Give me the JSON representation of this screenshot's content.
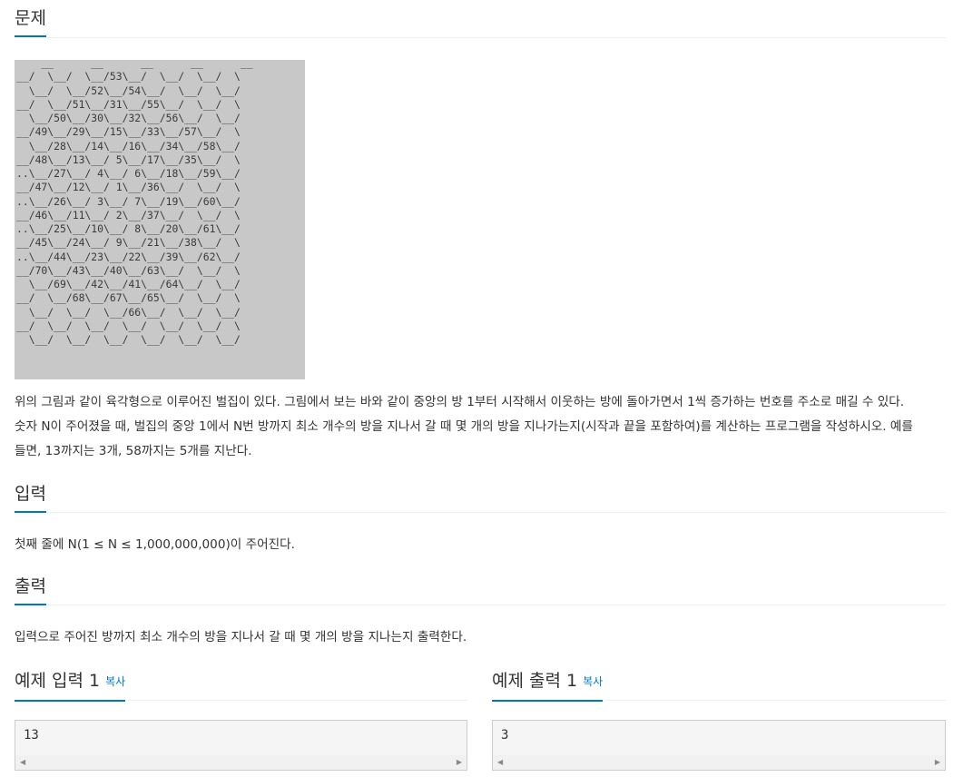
{
  "problem": {
    "title": "문제",
    "figure_text": "    __      __      __      __      __\n__/  \\__/  \\__/53\\__/  \\__/  \\__/  \\\n  \\__/  \\__/52\\__/54\\__/  \\__/  \\__/\n__/  \\__/51\\__/31\\__/55\\__/  \\__/  \\\n  \\__/50\\__/30\\__/32\\__/56\\__/  \\__/\n__/49\\__/29\\__/15\\__/33\\__/57\\__/  \\\n  \\__/28\\__/14\\__/16\\__/34\\__/58\\__/\n__/48\\__/13\\__/ 5\\__/17\\__/35\\__/  \\\n..\\__/27\\__/ 4\\__/ 6\\__/18\\__/59\\__/\n__/47\\__/12\\__/ 1\\__/36\\__/  \\__/  \\\n..\\__/26\\__/ 3\\__/ 7\\__/19\\__/60\\__/\n__/46\\__/11\\__/ 2\\__/37\\__/  \\__/  \\\n..\\__/25\\__/10\\__/ 8\\__/20\\__/61\\__/\n__/45\\__/24\\__/ 9\\__/21\\__/38\\__/  \\\n..\\__/44\\__/23\\__/22\\__/39\\__/62\\__/\n__/70\\__/43\\__/40\\__/63\\__/  \\__/  \\\n  \\__/69\\__/42\\__/41\\__/64\\__/  \\__/\n__/  \\__/68\\__/67\\__/65\\__/  \\__/  \\\n  \\__/  \\__/  \\__/66\\__/  \\__/  \\__/\n__/  \\__/  \\__/  \\__/  \\__/  \\__/  \\\n  \\__/  \\__/  \\__/  \\__/  \\__/  \\__/",
    "desc_line1": "위의 그림과 같이 육각형으로 이루어진 벌집이 있다. 그림에서 보는 바와 같이 중앙의 방 1부터 시작해서 이웃하는 방에 돌아가면서 1씩 증가하는 번호를 주소로 매길 수 있다.",
    "desc_line2": "숫자 N이 주어졌을 때, 벌집의 중앙 1에서 N번 방까지 최소 개수의 방을 지나서 갈 때 몇 개의 방을 지나가는지(시작과 끝을 포함하여)를 계산하는 프로그램을 작성하시오. 예를",
    "desc_line3": "들면, 13까지는 3개, 58까지는 5개를 지난다."
  },
  "input": {
    "title": "입력",
    "text": "첫째 줄에 N(1 ≤ N ≤ 1,000,000,000)이 주어진다."
  },
  "output": {
    "title": "출력",
    "text": "입력으로 주어진 방까지 최소 개수의 방을 지나서 갈 때 몇 개의 방을 지나는지 출력한다."
  },
  "sample_input": {
    "title": "예제 입력 1",
    "copy_label": "복사",
    "value": "13"
  },
  "sample_output": {
    "title": "예제 출력 1",
    "copy_label": "복사",
    "value": "3"
  },
  "colors": {
    "accent": "#0076c0",
    "figure_bg": "#c8c8c8"
  }
}
